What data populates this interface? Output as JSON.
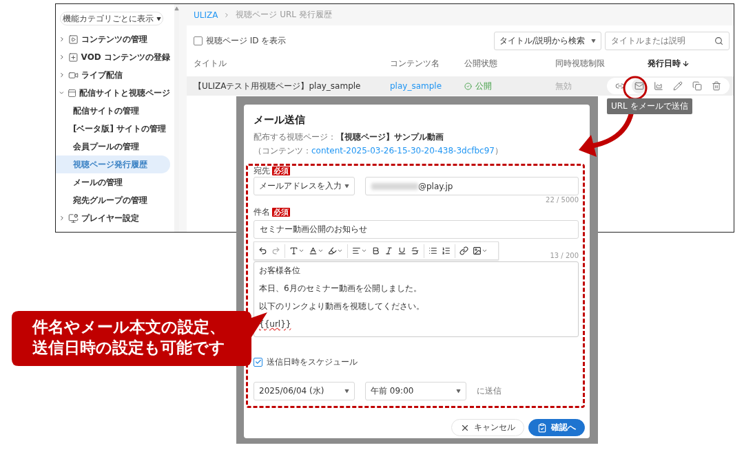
{
  "sidebar": {
    "filter_button": "機能カテゴリごとに表示",
    "items": [
      {
        "label": "コンテンツの管理",
        "expanded": false,
        "selected": false
      },
      {
        "label": "VOD コンテンツの登録",
        "expanded": false,
        "selected": false
      },
      {
        "label": "ライブ配信",
        "expanded": false,
        "selected": false
      },
      {
        "label": "配信サイトと視聴ページ",
        "expanded": true,
        "selected": false,
        "children": [
          {
            "label": "配信サイトの管理",
            "selected": false
          },
          {
            "label": "[ベータ版] サイトの管理",
            "selected": false
          },
          {
            "label": "会員プールの管理",
            "selected": false
          },
          {
            "label": "視聴ページ発行履歴",
            "selected": true
          },
          {
            "label": "メールの管理",
            "selected": false
          },
          {
            "label": "宛先グループの管理",
            "selected": false
          }
        ]
      },
      {
        "label": "プレイヤー設定",
        "expanded": false,
        "selected": false
      }
    ]
  },
  "breadcrumb": [
    "ULIZA",
    "視聴ページ URL 発行履歴"
  ],
  "filters": {
    "show_id": {
      "label": "視聴ページ ID を表示",
      "checked": false
    },
    "search_scope": "タイトル/説明から検索",
    "search": {
      "placeholder": "タイトルまたは説明"
    }
  },
  "table": {
    "columns": [
      {
        "label": "タイトル",
        "sorted": false
      },
      {
        "label": "コンテンツ名",
        "sorted": false
      },
      {
        "label": "公開状態",
        "sorted": false
      },
      {
        "label": "同時視聴制限",
        "sorted": false
      },
      {
        "label": "発行日時",
        "sorted": true
      }
    ],
    "rows": [
      {
        "title": "【ULIZAテスト用視聴ページ】play_sample",
        "content": "play_sample",
        "status": "公開",
        "limit": "無効",
        "selected": true
      }
    ]
  },
  "tooltip": "URL をメールで送信",
  "dialog": {
    "title": "メール送信",
    "target": "配布する視聴ページ：**【視聴ページ】サンプル動画**",
    "content_prefix": "（コンテンツ：",
    "content_id": "content-2025-03-26-15-30-20-438-3dcfbc97",
    "content_suffix": "）",
    "recipient": {
      "label": "宛先",
      "badge": "必須",
      "mode": "メールアドレスを入力",
      "value": "@play.jp",
      "counter": "22 / 5000"
    },
    "subject": {
      "label": "件名",
      "badge": "必須",
      "value": "セミナー動画公開のお知らせ",
      "counter": "13 / 200"
    },
    "body": [
      "お客様各位",
      "本日、6月のセミナー動画を公開しました。",
      "以下のリンクより動画を視聴してください。",
      "{{url}}"
    ],
    "schedule": {
      "label": "送信日時をスケジュール",
      "checked": true,
      "date": "2025/06/04 (水)",
      "time": "午前 09:00",
      "suffix": "に送信"
    },
    "buttons": [
      {
        "label": "キャンセル",
        "kind": "cancel"
      },
      {
        "label": "確認へ",
        "kind": "confirm"
      }
    ]
  },
  "callout": "件名やメール本文の設定、送信日時の設定も可能です"
}
